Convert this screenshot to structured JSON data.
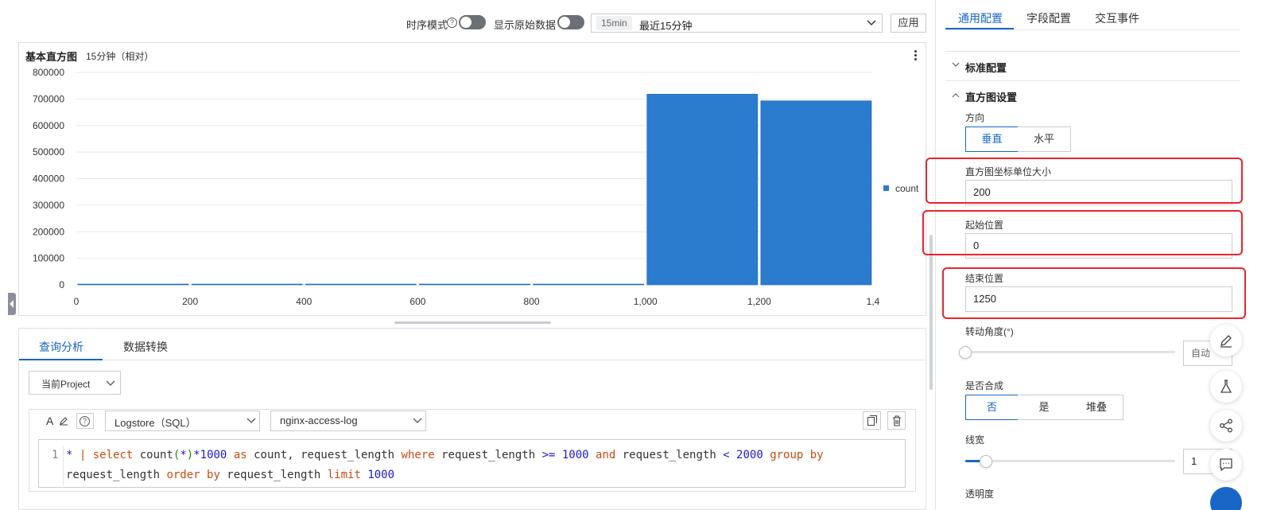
{
  "toolbar": {
    "timeseries_label": "时序模式",
    "raw_data_label": "显示原始数据",
    "time_tag": "15min",
    "time_range": "最近15分钟",
    "apply_label": "应用"
  },
  "chart_panel": {
    "title": "基本直方图",
    "subtitle": "15分钟（相对）"
  },
  "chart_data": {
    "type": "bar",
    "x": [
      0,
      200,
      400,
      600,
      800,
      1000,
      1200
    ],
    "bin_width": 200,
    "values": [
      0,
      0,
      0,
      0,
      0,
      718000,
      693000
    ],
    "x_tick_labels": [
      "0",
      "200",
      "400",
      "600",
      "800",
      "1,000",
      "1,200",
      "1,4"
    ],
    "y_tick_labels": [
      "0",
      "100000",
      "200000",
      "300000",
      "400000",
      "500000",
      "600000",
      "700000",
      "800000"
    ],
    "ylim": [
      0,
      800000
    ],
    "xlim": [
      0,
      1400
    ],
    "grid": true,
    "legend_position": "right",
    "series": [
      {
        "name": "count",
        "color": "#2b7bcf"
      }
    ]
  },
  "query_tabs": {
    "items": [
      {
        "label": "查询分析"
      },
      {
        "label": "数据转换"
      }
    ]
  },
  "query": {
    "project_select": "当前Project",
    "font_icon_text": "A",
    "logstore_type": "Logstore（SQL）",
    "logstore_name": "nginx-access-log",
    "line_number": "1"
  },
  "right_panel": {
    "tabs": [
      {
        "label": "通用配置"
      },
      {
        "label": "字段配置"
      },
      {
        "label": "交互事件"
      }
    ],
    "standard_config": "标准配置",
    "histogram_settings": "直方图设置",
    "direction": {
      "label": "方向",
      "options": [
        "垂直",
        "水平"
      ],
      "selected": "垂直"
    },
    "unit_size": {
      "label": "直方图坐标单位大小",
      "value": "200"
    },
    "start_pos": {
      "label": "起始位置",
      "value": "0"
    },
    "end_pos": {
      "label": "结束位置",
      "value": "1250"
    },
    "rotate": {
      "label": "转动角度(°)",
      "value": "自动"
    },
    "stack": {
      "label": "是否合成",
      "options": [
        "否",
        "是",
        "堆叠"
      ],
      "selected": "否"
    },
    "line_width": {
      "label": "线宽",
      "value": "1"
    },
    "opacity": {
      "label": "透明度"
    }
  },
  "colors": {
    "accent": "#1a66c6",
    "bar": "#2b7bcf",
    "highlight": "#e8242e"
  }
}
